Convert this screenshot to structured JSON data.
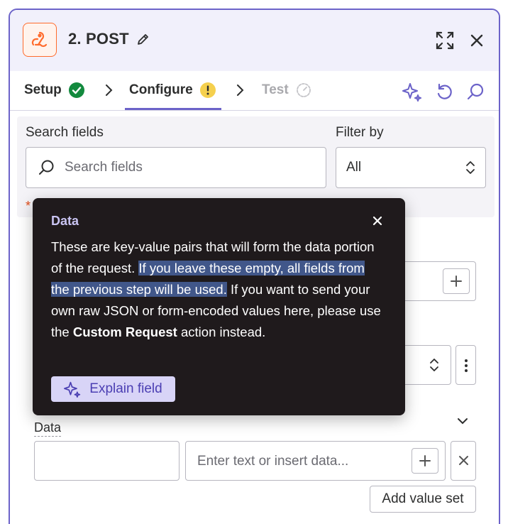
{
  "header": {
    "title": "2. POST",
    "app_icon": "webhook-icon",
    "accent": "#6c63c9"
  },
  "tabs": [
    {
      "label": "Setup",
      "status": "complete",
      "status_color": "#138a3e"
    },
    {
      "label": "Configure",
      "status": "warning",
      "status_color": "#f5d04e",
      "active": true
    },
    {
      "label": "Test",
      "status": "pending"
    }
  ],
  "search": {
    "label": "Search fields",
    "placeholder": "Search fields"
  },
  "filter": {
    "label": "Filter by",
    "value": "All"
  },
  "data_section": {
    "label": "Data",
    "value_placeholder": "Enter text or insert data...",
    "add_value_set": "Add value set"
  },
  "tooltip": {
    "title": "Data",
    "text_part1": "These are key-value pairs that will form the data portion of the request.",
    "text_highlight": "If you leave these empty, all fields from the previous step will be used.",
    "text_part2": "If you want to send your own raw JSON or form-encoded values here, please use the",
    "text_bold": "Custom Request",
    "text_part3": "action instead.",
    "explain_button": "Explain field"
  }
}
